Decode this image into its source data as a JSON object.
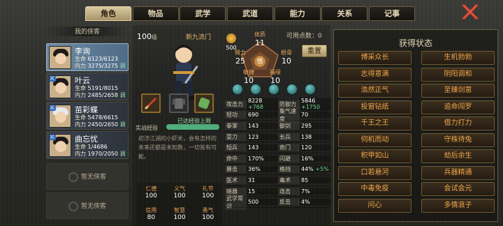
{
  "tabs": [
    "角色",
    "物品",
    "武学",
    "武道",
    "能力",
    "关系",
    "记事"
  ],
  "left": {
    "caption": "我的侠客",
    "heroes": [
      {
        "name": "李询",
        "hp_label": "生命",
        "hp": "6123/6123",
        "mp_label": "内力",
        "mp": "3275/3275",
        "badge": "",
        "tune": "调"
      },
      {
        "name": "叶云",
        "hp_label": "生命",
        "hp": "5191/8015",
        "mp_label": "内力",
        "mp": "2485/2658",
        "badge": "义",
        "tune": "调"
      },
      {
        "name": "苗彩蝶",
        "hp_label": "生命",
        "hp": "5478/6615",
        "mp_label": "内力",
        "mp": "2450/2650",
        "badge": "义",
        "tune": "调"
      },
      {
        "name": "曲忘忧",
        "hp_label": "生命",
        "hp": "1/4686",
        "mp_label": "内力",
        "mp": "1970/2050",
        "badge": "义",
        "tune": "调"
      }
    ],
    "empty_label": "暂无侠客"
  },
  "center": {
    "level": "100",
    "level_unit": "级",
    "sect": "新九流门",
    "potential_label": "可用点数：",
    "potential": "0",
    "money": "500",
    "stats": {
      "con": {
        "label": "体质",
        "value": "11"
      },
      "str": {
        "label": "臂力",
        "value": "25"
      },
      "dex": {
        "label": "根骨",
        "value": "10"
      },
      "agi": {
        "label": "敏捷",
        "value": "10"
      },
      "luck": {
        "label": "福缘",
        "value": "10"
      },
      "center_char": "悟"
    },
    "reset": "重置",
    "exp_label": "实战经验",
    "exp_max": "已达经验上限",
    "exp_progress": 1.0,
    "desc": "初涉江湖的小虾米，会有怎样的未来还都是未知数，一切皆有可能。",
    "virtues": [
      {
        "label": "仁德",
        "value": "100"
      },
      {
        "label": "义气",
        "value": "100"
      },
      {
        "label": "礼节",
        "value": "100"
      },
      {
        "label": "信用",
        "value": "80"
      },
      {
        "label": "智慧",
        "value": "100"
      },
      {
        "label": "勇气",
        "value": "100"
      }
    ],
    "attrs": [
      [
        "攻击力",
        "8228",
        "+768",
        "防御力",
        "5846",
        "+1750"
      ],
      [
        "轻功",
        "690",
        "",
        "集气速度",
        "70",
        ""
      ],
      [
        "拳掌",
        "143",
        "",
        "御剑",
        "295",
        ""
      ],
      [
        "耍刀",
        "123",
        "",
        "长兵",
        "138",
        ""
      ],
      [
        "短兵",
        "143",
        "",
        "奇门",
        "120",
        ""
      ],
      [
        "命中",
        "170%",
        "",
        "闪避",
        "16%",
        ""
      ],
      [
        "暴击",
        "36%",
        "",
        "格挡",
        "44%",
        "+5%"
      ],
      [
        "医术",
        "31",
        "",
        "毒术",
        "85",
        ""
      ],
      [
        "暗器",
        "15",
        "",
        "连击",
        "7%",
        ""
      ],
      [
        "武学常识",
        "500",
        "",
        "反击",
        "4%",
        ""
      ]
    ]
  },
  "right": {
    "title": "获得状态",
    "states": [
      "博采众长",
      "生机勃勃",
      "志得意满",
      "阴阳调和",
      "浩然正气",
      "至臻剑意",
      "投窗钻纸",
      "追命闯罗",
      "千王之王",
      "借力打力",
      "伺机而动",
      "守株待兔",
      "积甲如山",
      "劫后余生",
      "口若悬河",
      "兵器精通",
      "中毒免疫",
      "会试会元",
      "问心",
      "多情浪子"
    ]
  },
  "colors": {
    "accent": "#f0a64a",
    "tab_active": "#d9c99e",
    "hero_selected": "#6d8aa4"
  }
}
